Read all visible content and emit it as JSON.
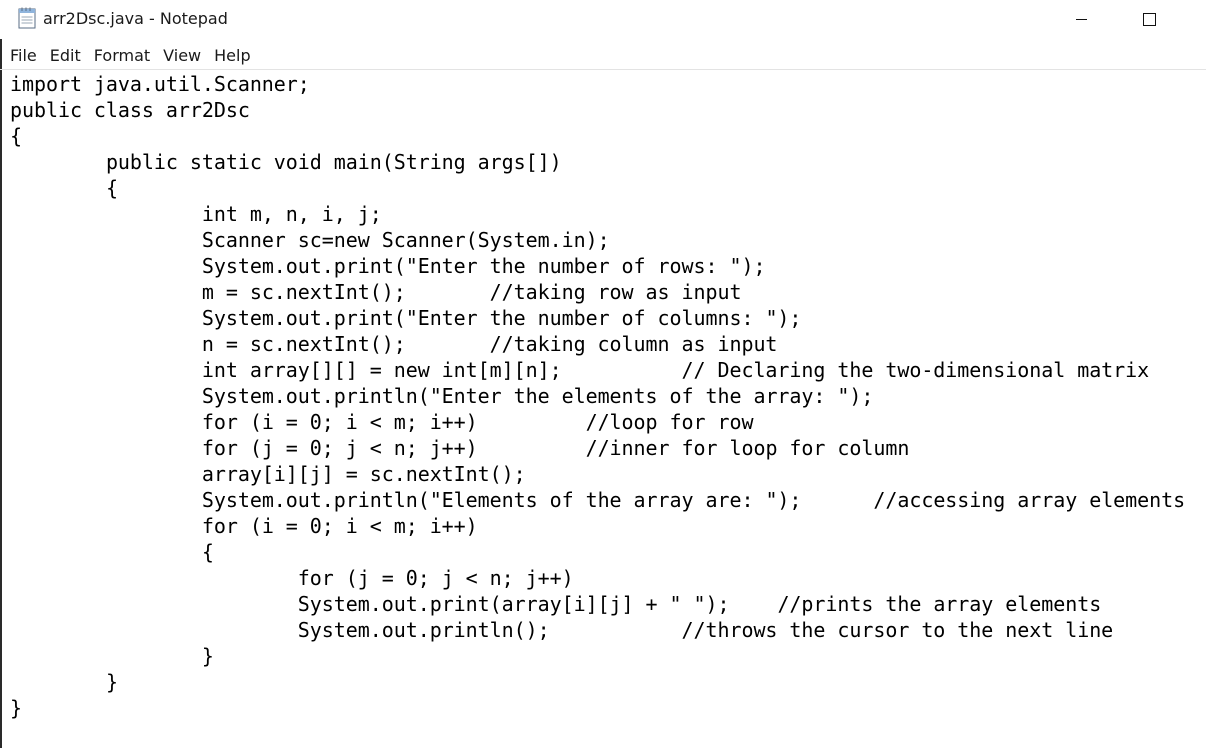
{
  "window": {
    "title": "arr2Dsc.java - Notepad",
    "icon": "notepad-icon",
    "controls": {
      "minimize": "minimize-icon",
      "maximize": "maximize-icon"
    }
  },
  "menu": {
    "items": [
      {
        "label": "File"
      },
      {
        "label": "Edit"
      },
      {
        "label": "Format"
      },
      {
        "label": "View"
      },
      {
        "label": "Help"
      }
    ]
  },
  "editor": {
    "lines": [
      "import java.util.Scanner;",
      "public class arr2Dsc",
      "{",
      "\tpublic static void main(String args[])",
      "\t{",
      "\t\tint m, n, i, j;",
      "\t\tScanner sc=new Scanner(System.in);",
      "\t\tSystem.out.print(\"Enter the number of rows: \");",
      "\t\tm = sc.nextInt();\t//taking row as input",
      "\t\tSystem.out.print(\"Enter the number of columns: \");",
      "\t\tn = sc.nextInt();\t//taking column as input",
      "\t\tint array[][] = new int[m][n];\t\t// Declaring the two-dimensional matrix",
      "\t\tSystem.out.println(\"Enter the elements of the array: \");",
      "\t\tfor (i = 0; i < m; i++)\t\t//loop for row",
      "\t\tfor (j = 0; j < n; j++)\t\t//inner for loop for column",
      "\t\tarray[i][j] = sc.nextInt();",
      "\t\tSystem.out.println(\"Elements of the array are: \");\t//accessing array elements",
      "\t\tfor (i = 0; i < m; i++)",
      "\t\t{",
      "\t\t\tfor (j = 0; j < n; j++)",
      "\t\t\tSystem.out.print(array[i][j] + \" \");\t//prints the array elements",
      "\t\t\tSystem.out.println();\t\t//throws the cursor to the next line",
      "\t\t}",
      "\t}",
      "}"
    ]
  }
}
